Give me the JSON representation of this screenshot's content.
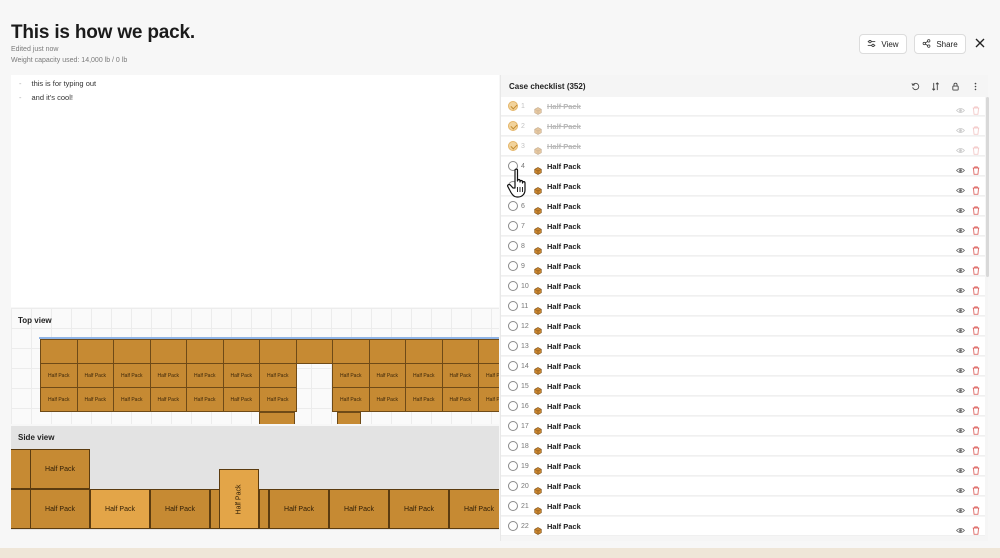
{
  "header": {
    "title": "This is how we pack.",
    "edited": "Edited just now",
    "capacity": "Weight capacity used: 14,000 lb / 0 lb",
    "view_label": "View",
    "share_label": "Share"
  },
  "notes": {
    "lines": [
      "this is for typing out",
      "and it's cool!"
    ]
  },
  "top_view": {
    "label": "Top view",
    "box_label": "Half Pack"
  },
  "side_view": {
    "label": "Side view",
    "box_label": "Half Pack"
  },
  "checklist": {
    "title": "Case checklist (352)",
    "items": [
      {
        "num": "1",
        "name": "Half Pack",
        "checked": true
      },
      {
        "num": "2",
        "name": "Half Pack",
        "checked": true
      },
      {
        "num": "3",
        "name": "Half Pack",
        "checked": true
      },
      {
        "num": "4",
        "name": "Half Pack",
        "checked": false
      },
      {
        "num": "5",
        "name": "Half Pack",
        "checked": false
      },
      {
        "num": "6",
        "name": "Half Pack",
        "checked": false
      },
      {
        "num": "7",
        "name": "Half Pack",
        "checked": false
      },
      {
        "num": "8",
        "name": "Half Pack",
        "checked": false
      },
      {
        "num": "9",
        "name": "Half Pack",
        "checked": false
      },
      {
        "num": "10",
        "name": "Half Pack",
        "checked": false
      },
      {
        "num": "11",
        "name": "Half Pack",
        "checked": false
      },
      {
        "num": "12",
        "name": "Half Pack",
        "checked": false
      },
      {
        "num": "13",
        "name": "Half Pack",
        "checked": false
      },
      {
        "num": "14",
        "name": "Half Pack",
        "checked": false
      },
      {
        "num": "15",
        "name": "Half Pack",
        "checked": false
      },
      {
        "num": "16",
        "name": "Half Pack",
        "checked": false
      },
      {
        "num": "17",
        "name": "Half Pack",
        "checked": false
      },
      {
        "num": "18",
        "name": "Half Pack",
        "checked": false
      },
      {
        "num": "19",
        "name": "Half Pack",
        "checked": false
      },
      {
        "num": "20",
        "name": "Half Pack",
        "checked": false
      },
      {
        "num": "21",
        "name": "Half Pack",
        "checked": false
      },
      {
        "num": "22",
        "name": "Half Pack",
        "checked": false
      }
    ]
  },
  "colors": {
    "box": "#c68a33",
    "box_highlight": "#e0a347",
    "checked": "#f2d39b",
    "delete": "#d9534f"
  },
  "icons": {
    "view": "sliders-icon",
    "share": "share-icon",
    "close": "close-icon",
    "reset": "rotate-ccw-icon",
    "sort": "sort-icon",
    "lock": "lock-icon",
    "more": "more-vertical-icon",
    "package": "package-icon",
    "eye": "eye-icon",
    "trash": "trash-icon"
  }
}
